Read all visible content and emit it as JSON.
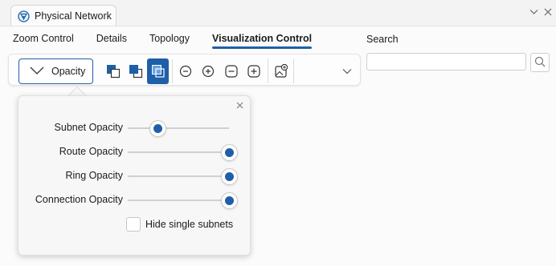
{
  "window": {
    "tab_title": "Physical Network",
    "collapse_icon": "chevron-down-icon",
    "close_icon": "close-icon"
  },
  "ribbon": {
    "tabs": [
      {
        "label": "Zoom Control",
        "active": false
      },
      {
        "label": "Details",
        "active": false
      },
      {
        "label": "Topology",
        "active": false
      },
      {
        "label": "Visualization Control",
        "active": true
      }
    ],
    "search_label": "Search",
    "search_value": "",
    "search_icon": "search-icon"
  },
  "toolbar": {
    "opacity_label": "Opacity",
    "icons": [
      "bring-forward-icon",
      "send-backward-icon",
      "layer-toggle-icon",
      "zoom-out-circle-icon",
      "zoom-in-circle-icon",
      "zoom-out-square-icon",
      "zoom-in-square-icon",
      "image-add-icon"
    ],
    "overflow_icon": "chevron-down-icon"
  },
  "popup": {
    "sliders": [
      {
        "label": "Subnet Opacity",
        "value": 0.29
      },
      {
        "label": "Route Opacity",
        "value": 1.0
      },
      {
        "label": "Ring Opacity",
        "value": 1.0
      },
      {
        "label": "Connection Opacity",
        "value": 1.0
      }
    ],
    "checkbox_label": "Hide single subnets",
    "checkbox_checked": false
  },
  "colors": {
    "accent": "#1f5fa8"
  }
}
